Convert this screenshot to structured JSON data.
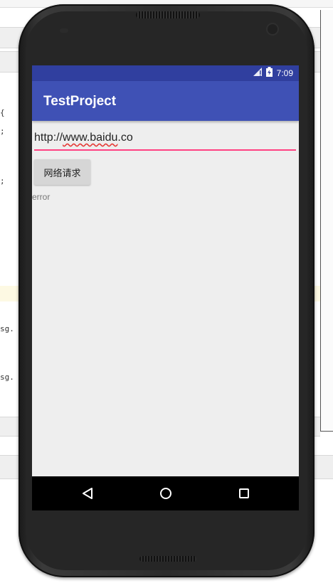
{
  "ide": {
    "fragments": [
      "{",
      ";",
      ";",
      "sg.",
      "sg."
    ]
  },
  "status_bar": {
    "time": "7:09",
    "icons": [
      "signal-icon",
      "battery-icon"
    ]
  },
  "app_bar": {
    "title": "TestProject"
  },
  "url_field": {
    "value": "http://www.baidu.co",
    "prefix": "http://",
    "misspelled": "www.baidu",
    "suffix": ".co"
  },
  "request_button": {
    "label": "网络请求"
  },
  "result": {
    "text": "error"
  },
  "nav_bar": {
    "buttons": [
      "back-icon",
      "home-icon",
      "recents-icon"
    ]
  },
  "colors": {
    "status_bar": "#303f9f",
    "app_bar": "#3f51b5",
    "accent": "#ff4081",
    "screen_bg": "#eeeeee"
  }
}
